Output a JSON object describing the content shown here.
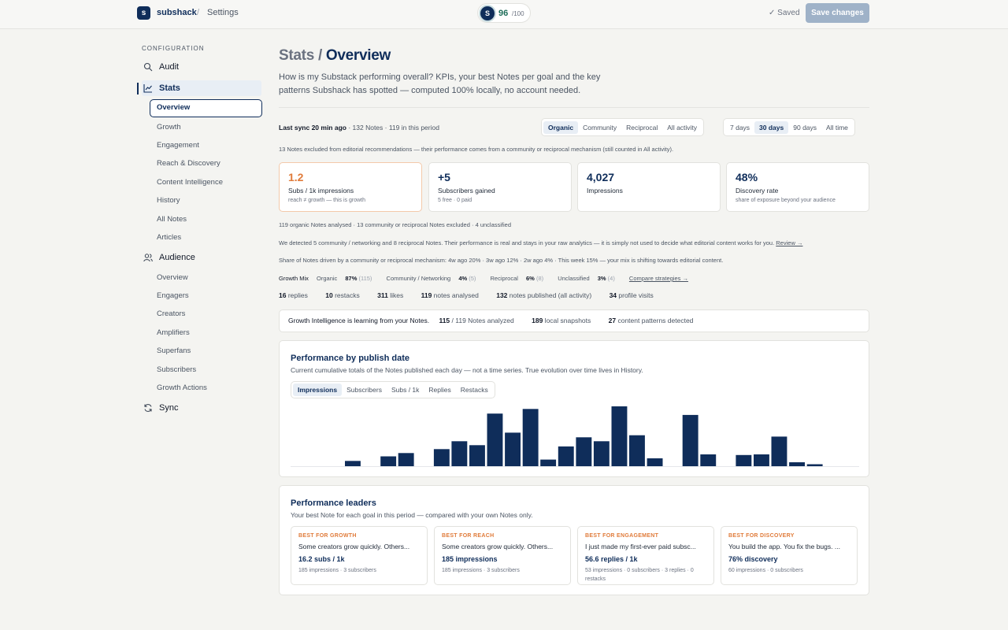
{
  "header": {
    "logo_letter": "s",
    "brand": "subshack",
    "separator": "/",
    "crumb": "Settings",
    "score_letter": "S",
    "score_value": "96",
    "score_max": "/100",
    "saved_label": "✓ Saved",
    "save_button": "Save changes"
  },
  "sidebar": {
    "heading": "CONFIGURATION",
    "audit": "Audit",
    "stats": "Stats",
    "stats_items": [
      "Overview",
      "Growth",
      "Engagement",
      "Reach & Discovery",
      "Content Intelligence",
      "History",
      "All Notes",
      "Articles"
    ],
    "audience": "Audience",
    "audience_items": [
      "Overview",
      "Engagers",
      "Creators",
      "Amplifiers",
      "Superfans",
      "Subscribers",
      "Growth Actions"
    ],
    "sync": "Sync"
  },
  "page": {
    "title_prefix": "Stats / ",
    "title_accent": "Overview",
    "subtitle": "How is my Substack performing overall? KPIs, your best Notes per goal and the key patterns Subshack has spotted — computed 100% locally, no account needed."
  },
  "sync_bar": {
    "last_sync": "Last sync 20 min ago",
    "rest": " · 132 Notes · 119 in this period",
    "filters": [
      "Organic",
      "Community",
      "Reciprocal",
      "All activity"
    ],
    "filter_active": 0,
    "ranges": [
      "7 days",
      "30 days",
      "90 days",
      "All time"
    ],
    "range_active": 1
  },
  "excluded_note": "13 Notes excluded from editorial recommendations — their performance comes from a community or reciprocal mechanism (still counted in All activity).",
  "kpis": [
    {
      "value": "1.2",
      "label": "Subs / 1k impressions",
      "sub": "reach ≠ growth — this is growth"
    },
    {
      "value": "+5",
      "label": "Subscribers gained",
      "sub": "5 free · 0 paid"
    },
    {
      "value": "4,027",
      "label": "Impressions",
      "sub": ""
    },
    {
      "value": "48%",
      "label": "Discovery rate",
      "sub": "share of exposure beyond your audience"
    }
  ],
  "analysis": {
    "analysed": "119 organic Notes analysed · 13 community or reciprocal Notes excluded · 4 unclassified",
    "detected": "We detected 5 community / networking and 8 reciprocal Notes. Their performance is real and stays in your raw analytics — it is simply not used to decide what editorial content works for you. ",
    "review_link": "Review →",
    "share": "Share of Notes driven by a community or reciprocal mechanism: 4w ago 20% · 3w ago 12% · 2w ago 4% · This week 15% — your mix is shifting towards editorial content."
  },
  "mix": {
    "label": "Growth Mix",
    "organic_label": "Organic ",
    "organic_pct": "87%",
    "organic_n": " (115)",
    "community_label": "Community / Networking ",
    "community_pct": "4%",
    "community_n": " (5)",
    "reciprocal_label": "Reciprocal ",
    "reciprocal_pct": "6%",
    "reciprocal_n": " (8)",
    "unclassified_label": "Unclassified ",
    "unclassified_pct": "3%",
    "unclassified_n": " (4)",
    "compare_link": "Compare strategies →"
  },
  "counts": [
    {
      "n": "16",
      "label": " replies"
    },
    {
      "n": "10",
      "label": " restacks"
    },
    {
      "n": "311",
      "label": " likes"
    },
    {
      "n": "119",
      "label": " notes analysed"
    },
    {
      "n": "132",
      "label": " notes published (all activity)"
    },
    {
      "n": "34",
      "label": " profile visits"
    }
  ],
  "growth_intel": {
    "text": "Growth Intelligence is learning from your Notes.",
    "analyzed_n": "115",
    "analyzed_label": " / 119 Notes analyzed",
    "snapshots_n": "189",
    "snapshots_label": " local snapshots",
    "patterns_n": "27",
    "patterns_label": " content patterns detected"
  },
  "perf_chart": {
    "title": "Performance by publish date",
    "subtitle": "Current cumulative totals of the Notes published each day — not a time series. True evolution over time lives in History.",
    "tabs": [
      "Impressions",
      "Subscribers",
      "Subs / 1k",
      "Replies",
      "Restacks"
    ],
    "tab_active": 0
  },
  "chart_data": {
    "type": "bar",
    "series": [
      {
        "values": [
          0,
          0,
          0,
          8,
          0,
          15,
          20,
          0,
          26,
          38,
          32,
          80,
          51,
          87,
          10,
          30,
          44,
          38,
          91,
          47,
          12,
          0,
          78,
          18,
          0,
          17,
          18,
          45,
          6,
          3,
          0,
          0
        ]
      }
    ],
    "color": "#0f2d5a",
    "grid": false
  },
  "leaders": {
    "title": "Performance leaders",
    "subtitle": "Your best Note for each goal in this period — compared with your own Notes only.",
    "items": [
      {
        "tag": "BEST FOR GROWTH",
        "text": "Some creators grow quickly. Others...",
        "metric": "16.2 subs / 1k",
        "detail": "185 impressions · 3 subscribers"
      },
      {
        "tag": "BEST FOR REACH",
        "text": "Some creators grow quickly. Others...",
        "metric": "185 impressions",
        "detail": "185 impressions · 3 subscribers"
      },
      {
        "tag": "BEST FOR ENGAGEMENT",
        "text": "I just made my first-ever paid subsc...",
        "metric": "56.6 replies / 1k",
        "detail": "53 impressions · 0 subscribers · 3 replies · 0 restacks"
      },
      {
        "tag": "BEST FOR DISCOVERY",
        "text": "You build the app. You fix the bugs. ...",
        "metric": "76% discovery",
        "detail": "60 impressions · 0 subscribers"
      }
    ]
  }
}
